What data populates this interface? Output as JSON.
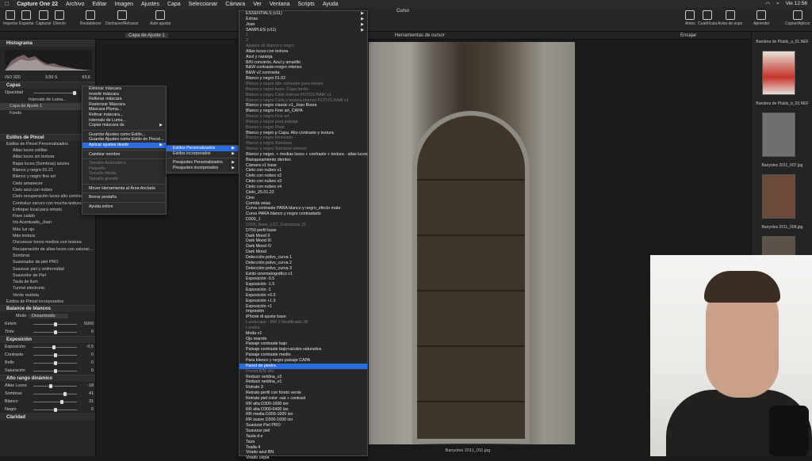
{
  "menubar": {
    "app": "Capture One 22",
    "items": [
      "Archivo",
      "Editar",
      "Imagen",
      "Ajustes",
      "Capa",
      "Seleccionar",
      "Cámara",
      "Ver",
      "Ventana",
      "Scripts",
      "Ayuda"
    ],
    "clock": "Vie 12:56"
  },
  "toolbar": {
    "left": [
      "Importar",
      "Exportar",
      "Capturar",
      "Capturar",
      "Directo"
    ],
    "mid": [
      "Restablecer",
      "Deshacer/Rehacer",
      "Auto ajustar"
    ],
    "right": [
      "Antes",
      "Cuadrícula",
      "Aviso de expo",
      "Aprender",
      "Copiar/Aplicar"
    ]
  },
  "title": "Curso",
  "subbar": {
    "layer": "Capa de Ajuste 1",
    "cursor_tools": "Herramientas de cursor",
    "zoom": "Encajar"
  },
  "left": {
    "histogram": "Histograma",
    "iso": "ISO 320",
    "shutter": "1/30 S",
    "aperture": "f/3,6",
    "layers": "Capas",
    "opacity": "Opacidad",
    "luma": "Intervalo de Luma...",
    "layer1": "Capa de Ajuste 1",
    "fondo": "Fondo",
    "styles_title": "Estilos de Pincel",
    "styles_custom": "Estilos de Pincel Personalizados",
    "styles": [
      "Altas luces colillas",
      "Altas luces sin textura",
      "Bajas luces (Sombras) azules",
      "Blanco y negro 01.21",
      "Blanco y negro fine art",
      "Cielo amanecer",
      "Cielo azul con nubes",
      "Cielo recuperación luces alto contraste",
      "Contraluz oscuro con mucha textura",
      "Enfoque local para retrato",
      "Flare calido",
      "Iris Acentuado_Joan",
      "Más luz ojo",
      "Más textura",
      "Oscurecer tonos medios con textura",
      "Recuperación de altas luces con saturac...",
      "Sombras",
      "Suavizador de piel PRO",
      "Suavizar piel y uniformidad",
      "Suavizdor de Piel",
      "Taula de llum",
      "Tunnel electronic",
      "Verde realista"
    ],
    "styles_embedded": "Estilos de Pincel incorporados",
    "wb": "Balance de blancos",
    "mode_lab": "Modo",
    "mode_val": "Desactivado",
    "kelvin": "Kelvin",
    "kelvin_val": "5000",
    "tint": "Tinte",
    "tint_val": "0",
    "exposure_title": "Exposición",
    "exposure": "Exposición",
    "exposure_val": "-0,5",
    "contrast": "Contraste",
    "contrast_val": "0",
    "brightness": "Brillo",
    "brightness_val": "0",
    "saturation": "Saturación",
    "saturation_val": "0",
    "hdr_title": "Alto rango dinámico",
    "hl": "Altas Luces",
    "hl_val": "-18",
    "sh": "Sombras",
    "sh_val": "41",
    "wh": "Blanco",
    "wh_val": "31",
    "bl": "Negro",
    "bl_val": "0",
    "clarity_title": "Claridad"
  },
  "menu1": {
    "items": [
      "Eliminar máscara",
      "Invertir máscara",
      "Rellenar máscara",
      "Rasterizar Máscara",
      "Máscara Pluma...",
      "Refinar máscara...",
      "Intervalo de Luma...",
      "Copiar máscara de",
      "Guardar Ajustes como Estilo...",
      "Guardar Ajustes como Estilo de Pincel...",
      "Aplicar ajustes desde",
      "Cambiar nombre",
      "Tamaño Automático",
      "Pequeño",
      "Tamaño Medio",
      "Tamaño grande",
      "Mover Herramienta al Área Anclada",
      "Borrar pestaña",
      "Ayuda online"
    ]
  },
  "menu2": {
    "items": [
      "Estilos Personalizados",
      "Estilos incorporados",
      "Preajustes Personalizados",
      "Preajustes incorporados"
    ]
  },
  "bigmenu": {
    "items": [
      "ESSENTIALS (v11)",
      "Extras",
      "Joan",
      "SAMPLES (v11)",
      "1",
      "2",
      "Ajustes de blanco y negro",
      "Altas luces con textura",
      "Azul y naranja",
      "B/N concierto. Azul y amarillo",
      "B&W contraste+negro intenso",
      "B&W v2 contrasta",
      "Blanco y negro 01.02",
      "Blanco y negro alto contraste para retrato",
      "Blanco y negro base. Capa fondo",
      "Blanco y negro Cielo intenso FOTOS RAW v1",
      "Blanco y negro Cielo y textura intenso FOTOS RAW v1",
      "Blanco y negro classic v1_Joan Bosra",
      "Blanco y negro Fine art_CAPA",
      "Blanco y negro Fine art",
      "Blanco y negro para paisaje",
      "Blanco y negro Pivat",
      "Blanco y negro p Capa. Alto contraste y textura",
      "Blanco y negro Revelado",
      "Blanco y negro Sombras",
      "Blanco y negro Sombras intenso",
      "Blanco y negro. + medias luces + contraste + textura - altas luces",
      "Blanqueamiento dientes",
      "Cámara v1 base",
      "Cielo con nubes v1",
      "Cielo con nubes v2",
      "Cielo con nubes v3",
      "Cielo con nubes v4",
      "Cielo_25.01.22",
      "Cine",
      "Corrida velas",
      "Curva contraste PARA blanco y negro_efecto mate",
      "Curva PARA blanco y negro contrastado",
      "D300_1",
      "D300_Base_LCC_Estructura 15",
      "D750 perfil base",
      "Dark Mood II",
      "Dark Mood III",
      "Dark Mood IV",
      "Dark Mood",
      "Detección polvo_curva 1",
      "Detección polvo_curva 2",
      "Detección polvo_curva 3",
      "Estilo cinematográfico v1",
      "Exposición -0.5",
      "Exposición -1.5",
      "Exposición -1",
      "Exposición +0.5",
      "Exposición +1.5",
      "Exposición +1",
      "Impresión",
      "iPhone di ajuste base",
      "Landscape - BW 2 Modificado JB",
      "London",
      "Moda v1",
      "Ojo marrón",
      "Paisaje contraste bajo",
      "Paisaje contraste bajo+azules saturados",
      "Paisaje contraste medio",
      "Para blanco y negro paisaje CAPA",
      "Pared de piedra",
      "Preset B/N alto",
      "Reducir neblina_v2",
      "Reducir neblina_v1",
      "Retrato 3",
      "Retrato perfil con fondo verde",
      "Retrato piel color -sat + contrast",
      "RR alta D300-1600 iso",
      "RR alta D300-6400 iso",
      "RR media D300-1600 iso",
      "RR suave D300-1600 iso",
      "Suavizar Piel PRO",
      "Suavizar piel",
      "Taula d e",
      "Taza",
      "Toalla 4",
      "Virado azul BN",
      "Virado cepia"
    ]
  },
  "filmstrip": {
    "labels": [
      "Bandera de Plaids_a_01.NEF",
      "Bandera de Plaids_b_03.NEF",
      "Banyoles 2011_007.jpg",
      "Banyoles 2011_008.jpg"
    ]
  },
  "caption": "Banyoles 2011_011.jpg"
}
